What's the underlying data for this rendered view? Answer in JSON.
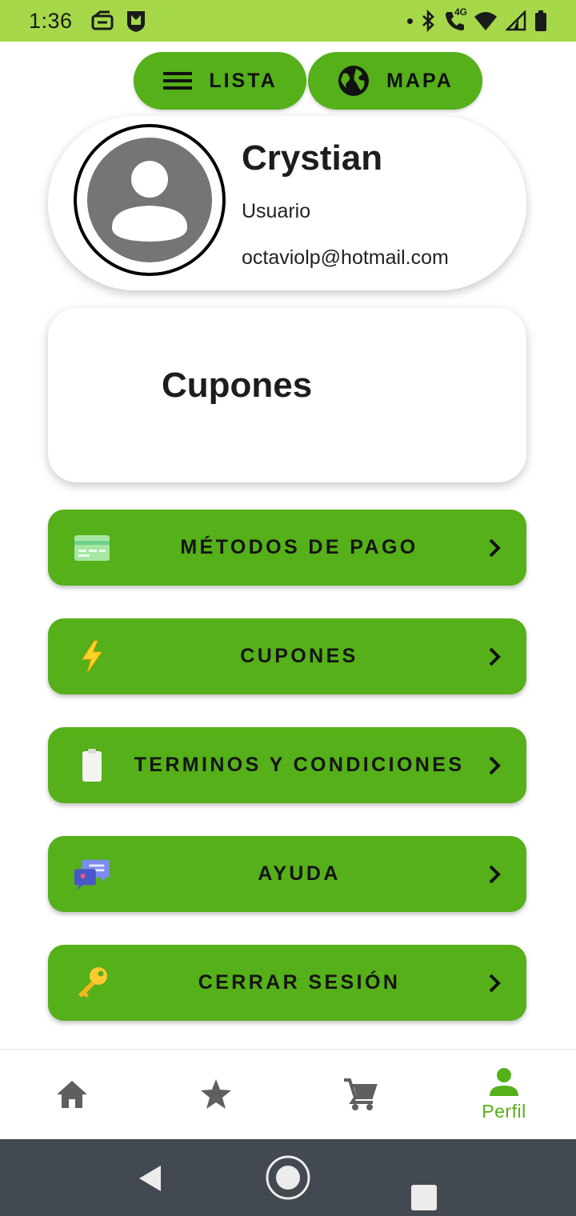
{
  "status_bar": {
    "time": "1:36",
    "network": "4G",
    "background_color": "#a6d84a"
  },
  "toggle": {
    "lista_label": "LISTA",
    "mapa_label": "MAPA",
    "lista_icon": "menu-icon",
    "mapa_icon": "globe-icon"
  },
  "profile": {
    "name": "Crystian",
    "role": "Usuario",
    "email": "octaviolp@hotmail.com",
    "avatar_icon": "account-circle-icon"
  },
  "coupons_card": {
    "title": "Cupones"
  },
  "menu": [
    {
      "label": "MÉTODOS DE PAGO",
      "icon": "credit-card-icon"
    },
    {
      "label": "CUPONES",
      "icon": "lightning-icon"
    },
    {
      "label": "TERMINOS Y CONDICIONES",
      "icon": "clipboard-icon"
    },
    {
      "label": "AYUDA",
      "icon": "chat-bubbles-icon"
    },
    {
      "label": "CERRAR SESIÓN",
      "icon": "key-icon"
    }
  ],
  "bottom_nav": {
    "items": [
      {
        "icon": "home-icon",
        "label": ""
      },
      {
        "icon": "star-icon",
        "label": ""
      },
      {
        "icon": "cart-icon",
        "label": ""
      },
      {
        "icon": "person-icon",
        "label": "Perfil",
        "active": true
      }
    ]
  },
  "colors": {
    "brand_green": "#55b019",
    "status_green": "#a6d84a",
    "system_nav": "#434950"
  }
}
